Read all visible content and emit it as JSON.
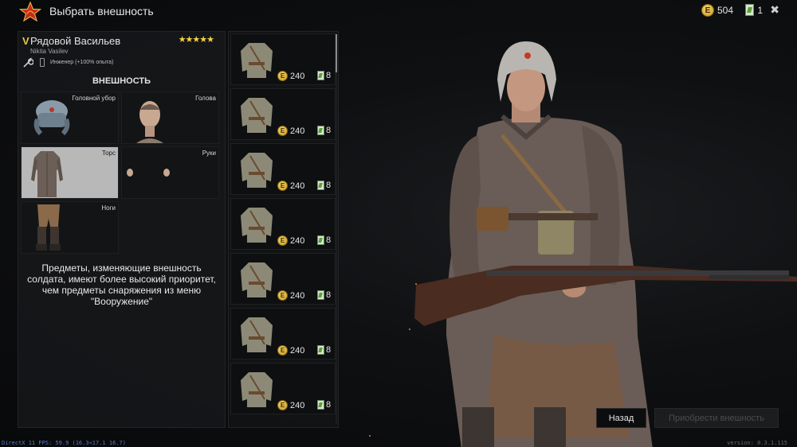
{
  "header": {
    "title": "Выбрать внешность",
    "gold": "504",
    "tickets": "1",
    "close_icon": "close-icon"
  },
  "soldier": {
    "rank": "V",
    "name": "Рядовой Васильев",
    "subname": "Nikita Vasilev",
    "stars": "★★★★★",
    "class_info": "Инженер  (+100% опыта)"
  },
  "appearance": {
    "heading": "ВНЕШНОСТЬ",
    "slots": [
      {
        "label": "Головной убор"
      },
      {
        "label": "Голова"
      },
      {
        "label": "Торс"
      },
      {
        "label": "Руки"
      },
      {
        "label": "Ноги"
      }
    ],
    "note": "Предметы, изменяющие внешность солдата, имеют более высокий приоритет, чем предметы снаряжения из меню \"Вооружение\""
  },
  "items": [
    {
      "price": "240",
      "tickets": "8"
    },
    {
      "price": "240",
      "tickets": "8"
    },
    {
      "price": "240",
      "tickets": "8"
    },
    {
      "price": "240",
      "tickets": "8"
    },
    {
      "price": "240",
      "tickets": "8"
    },
    {
      "price": "240",
      "tickets": "8"
    },
    {
      "price": "240",
      "tickets": "8"
    }
  ],
  "buttons": {
    "back": "Назад",
    "buy": "Приобрести внешность"
  },
  "footer": {
    "fps": "DirectX 11 FPS: 59.9 (16.3<17.1 16.7)",
    "version": "version: 0.3.1.115"
  },
  "colors": {
    "gold": "#e8c84a",
    "panel": "#161719",
    "selected": "#b8b8b8",
    "star_red": "#c62a1c"
  }
}
